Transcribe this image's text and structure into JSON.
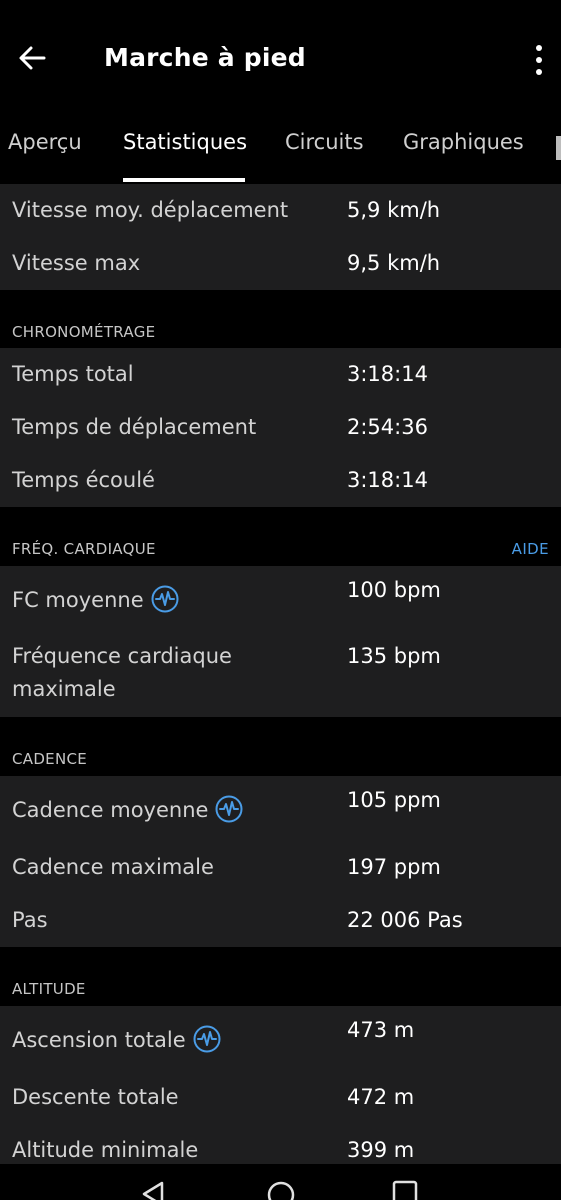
{
  "app_bar": {
    "title": "Marche à pied",
    "back_icon": "arrow-left-icon",
    "menu_icon": "more-vert-icon"
  },
  "tabs": [
    {
      "label": "Aperçu",
      "active": false
    },
    {
      "label": "Statistiques",
      "active": true
    },
    {
      "label": "Circuits",
      "active": false
    },
    {
      "label": "Graphiques",
      "active": false
    }
  ],
  "speed": {
    "avg_moving_label": "Vitesse moy. déplacement",
    "avg_moving_value": "5,9 km/h",
    "max_label": "Vitesse max",
    "max_value": "9,5 km/h"
  },
  "timing": {
    "section": "CHRONOMÉTRAGE",
    "total_label": "Temps total",
    "total_value": "3:18:14",
    "moving_label": "Temps de déplacement",
    "moving_value": "2:54:36",
    "elapsed_label": "Temps écoulé",
    "elapsed_value": "3:18:14"
  },
  "heart_rate": {
    "section": "FRÉQ. CARDIAQUE",
    "help": "AIDE",
    "avg_label": "FC moyenne",
    "avg_value": "100 bpm",
    "max_label": "Fréquence cardiaque maximale",
    "max_value": "135 bpm"
  },
  "cadence": {
    "section": "CADENCE",
    "avg_label": "Cadence moyenne",
    "avg_value": "105 ppm",
    "max_label": "Cadence maximale",
    "max_value": "197 ppm",
    "steps_label": "Pas",
    "steps_value": "22 006 Pas"
  },
  "altitude": {
    "section": "ALTITUDE",
    "ascent_label": "Ascension totale",
    "ascent_value": "473 m",
    "descent_label": "Descente totale",
    "descent_value": "472 m",
    "min_label": "Altitude minimale",
    "min_value": "399 m"
  },
  "colors": {
    "background": "#000000",
    "card": "#1e1e1f",
    "accent": "#4a9ce6"
  }
}
